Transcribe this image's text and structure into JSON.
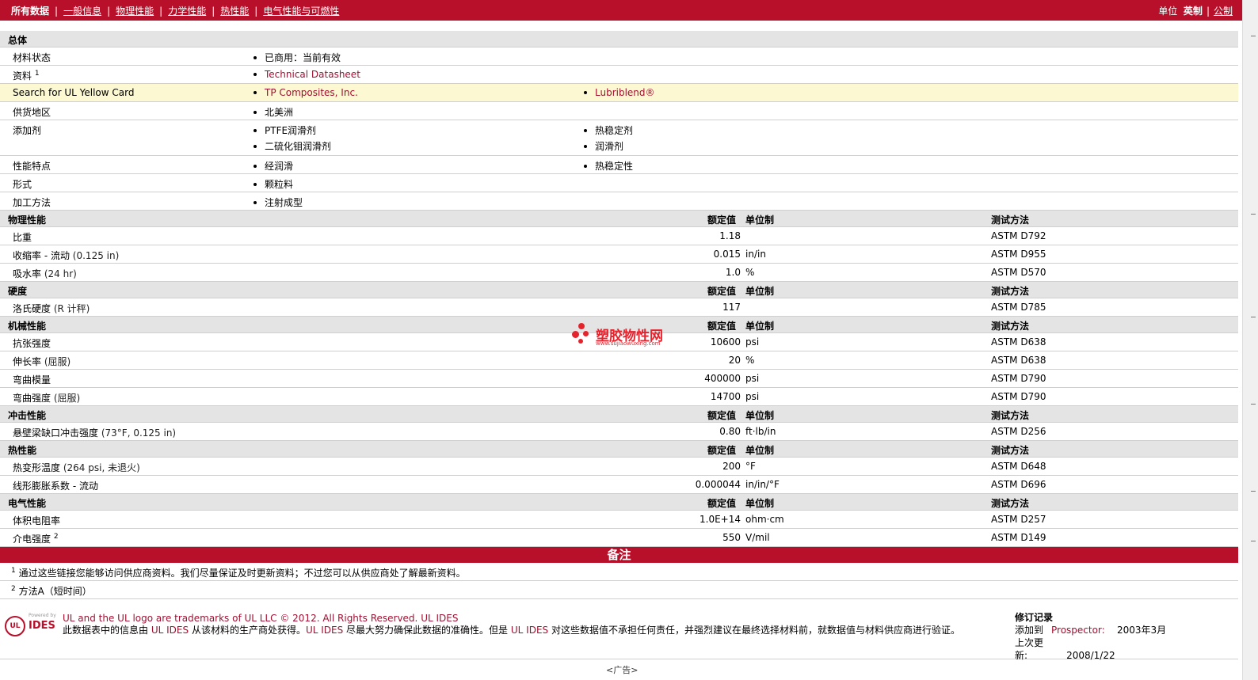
{
  "topbar": {
    "tabs": [
      {
        "label": "所有数据",
        "current": true
      },
      {
        "label": "一般信息"
      },
      {
        "label": "物理性能"
      },
      {
        "label": "力学性能"
      },
      {
        "label": "热性能"
      },
      {
        "label": "电气性能与可燃性"
      }
    ],
    "units_label": "单位",
    "unit_english": "英制",
    "unit_metric": "公制"
  },
  "general": {
    "title": "总体",
    "rows": [
      {
        "label": "材料状态",
        "c1": [
          "已商用：当前有效"
        ]
      },
      {
        "label": "资料",
        "sup": "1",
        "c1": [
          "Technical Datasheet"
        ]
      },
      {
        "label": "Search for UL Yellow Card",
        "c1": [
          "TP Composites, Inc."
        ],
        "c2": [
          "Lubriblend®"
        ]
      },
      {
        "label": "供货地区",
        "c1": [
          "北美洲"
        ]
      },
      {
        "label": "添加剂",
        "c1": [
          "PTFE润滑剂",
          "二硫化钼润滑剂"
        ],
        "c2": [
          "热稳定剂",
          "润滑剂"
        ]
      },
      {
        "label": "性能特点",
        "c1": [
          "经润滑"
        ],
        "c2": [
          "热稳定性"
        ]
      },
      {
        "label": "形式",
        "c1": [
          "颗粒料"
        ]
      },
      {
        "label": "加工方法",
        "c1": [
          "注射成型"
        ]
      }
    ]
  },
  "headers": {
    "rated": "额定值",
    "unit": "单位制",
    "method": "测试方法"
  },
  "sections": [
    {
      "title": "物理性能",
      "rows": [
        {
          "label": "比重",
          "cond": "",
          "value": "1.18",
          "unit": "",
          "method": "ASTM D792"
        },
        {
          "label": "收缩率 - 流动",
          "cond": "(0.125 in)",
          "value": "0.015",
          "unit": "in/in",
          "method": "ASTM D955"
        },
        {
          "label": "吸水率",
          "cond": "(24 hr)",
          "value": "1.0",
          "unit": "%",
          "method": "ASTM D570"
        }
      ]
    },
    {
      "title": "硬度",
      "rows": [
        {
          "label": "洛氏硬度",
          "cond": "(R 计秤)",
          "value": "117",
          "unit": "",
          "method": "ASTM D785"
        }
      ]
    },
    {
      "title": "机械性能",
      "rows": [
        {
          "label": "抗张强度",
          "cond": "",
          "value": "10600",
          "unit": "psi",
          "method": "ASTM D638"
        },
        {
          "label": "伸长率",
          "cond": "(屈服)",
          "value": "20",
          "unit": "%",
          "method": "ASTM D638"
        },
        {
          "label": "弯曲模量",
          "cond": "",
          "value": "400000",
          "unit": "psi",
          "method": "ASTM D790"
        },
        {
          "label": "弯曲强度",
          "cond": "(屈服)",
          "value": "14700",
          "unit": "psi",
          "method": "ASTM D790"
        }
      ]
    },
    {
      "title": "冲击性能",
      "rows": [
        {
          "label": "悬壁梁缺口冲击强度",
          "cond": "(73°F, 0.125 in)",
          "value": "0.80",
          "unit": "ft·lb/in",
          "method": "ASTM D256"
        }
      ]
    },
    {
      "title": "热性能",
      "rows": [
        {
          "label": "热变形温度",
          "cond": "(264 psi, 未退火)",
          "value": "200",
          "unit": "°F",
          "method": "ASTM D648"
        },
        {
          "label": "线形膨胀系数 - 流动",
          "cond": "",
          "value": "0.000044",
          "unit": "in/in/°F",
          "method": "ASTM D696"
        }
      ]
    },
    {
      "title": "电气性能",
      "rows": [
        {
          "label": "体积电阻率",
          "cond": "",
          "value": "1.0E+14",
          "unit": "ohm·cm",
          "method": "ASTM D257"
        },
        {
          "label": "介电强度",
          "sup": "2",
          "cond": "",
          "value": "550",
          "unit": "V/mil",
          "method": "ASTM D149"
        }
      ]
    }
  ],
  "notes": {
    "title": "备注",
    "items": [
      {
        "n": "1",
        "text": "通过这些链接您能够访问供应商资料。我们尽量保证及时更新资料；不过您可以从供应商处了解最新资料。"
      },
      {
        "n": "2",
        "text": "方法A（短时间）"
      }
    ]
  },
  "footer": {
    "logo_powered": "Powered by",
    "logo_ul": "UL",
    "logo_ides": "IDES",
    "line1": "UL and the UL logo are trademarks of UL LLC © 2012. All Rights Reserved.",
    "line1_link": "UL IDES",
    "line2a": "此数据表中的信息由",
    "line2_ul1": "UL IDES",
    "line2b": "从该材料的生产商处获得。",
    "line2_ul2": "UL IDES",
    "line2c": "尽最大努力确保此数据的准确性。但是",
    "line2_ul3": "UL IDES",
    "line2d": "对这些数据值不承担任何责任，并强烈建议在最终选择材料前，就数据值与材料供应商进行验证。",
    "rev_title": "修订记录",
    "added_label": "添加到",
    "added_source": "Prospector:",
    "added_date": "2003年3月",
    "updated_label": "上次更新:",
    "updated_date": "2008/1/22",
    "cut_text": "<广告>"
  },
  "watermark": {
    "name": "塑胶物性网",
    "url": "www.sujiaowuxing.com"
  }
}
